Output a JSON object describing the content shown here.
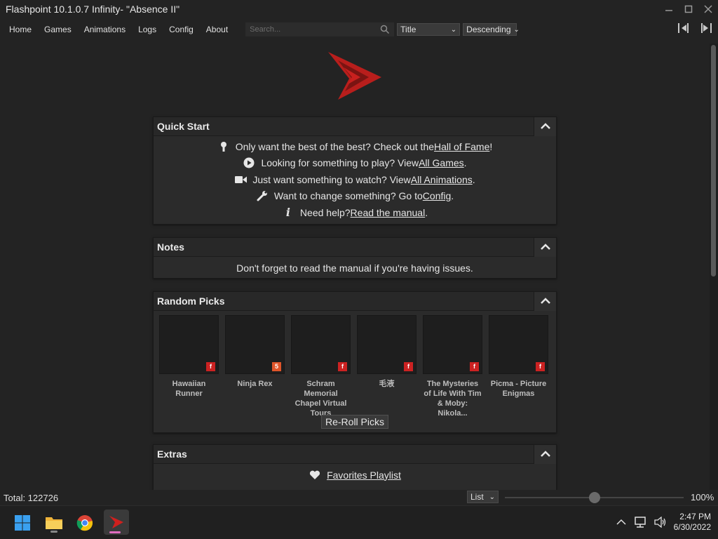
{
  "window": {
    "title": "Flashpoint 10.1.0.7 Infinity- \"Absence II\"",
    "controls": [
      "minimize-icon",
      "maximize-icon",
      "close-icon"
    ]
  },
  "menu": {
    "items": [
      "Home",
      "Games",
      "Animations",
      "Logs",
      "Config",
      "About"
    ]
  },
  "search": {
    "placeholder": "Search...",
    "value": ""
  },
  "sort_field": {
    "selected": "Title"
  },
  "sort_order": {
    "selected": "Descending"
  },
  "quick_start": {
    "title": "Quick Start",
    "lines": [
      {
        "icon": "award-icon",
        "pre": "Only want the best of the best? Check out the ",
        "link": "Hall of Fame",
        "post": "!"
      },
      {
        "icon": "play-circle-icon",
        "pre": "Looking for something to play? View ",
        "link": "All Games",
        "post": "."
      },
      {
        "icon": "video-camera-icon",
        "pre": "Just want something to watch? View ",
        "link": "All Animations",
        "post": "."
      },
      {
        "icon": "wrench-icon",
        "pre": "Want to change something? Go to ",
        "link": "Config",
        "post": "."
      },
      {
        "icon": "info-icon",
        "pre": "Need help? ",
        "link": "Read the manual",
        "post": "."
      }
    ]
  },
  "notes": {
    "title": "Notes",
    "text": "Don't forget to read the manual if you're having issues."
  },
  "random_picks": {
    "title": "Random Picks",
    "picks": [
      {
        "name": "Hawaiian Runner",
        "platform": "flash-icon",
        "badge": "f"
      },
      {
        "name": "Ninja Rex",
        "platform": "html5-icon",
        "badge": "5"
      },
      {
        "name": "Schram Memorial Chapel Virtual Tours",
        "platform": "flash-icon",
        "badge": "f"
      },
      {
        "name": "毛液",
        "platform": "flash-icon",
        "badge": "f"
      },
      {
        "name": "The Mysteries of Life With Tim & Moby: Nikola...",
        "platform": "flash-icon",
        "badge": "f"
      },
      {
        "name": "Picma - Picture Enigmas",
        "platform": "flash-icon",
        "badge": "f"
      }
    ],
    "reroll_label": "Re-Roll Picks"
  },
  "extras": {
    "title": "Extras",
    "items": [
      {
        "icon": "heart-icon",
        "label": "Favorites Playlist"
      }
    ]
  },
  "statusbar": {
    "total": "Total: 122726",
    "view_mode": "List",
    "zoom_label": "100%",
    "zoom_level": 0.5
  },
  "taskbar": {
    "apps": [
      "windows-start-icon",
      "file-explorer-icon",
      "chrome-icon",
      "flashpoint-icon"
    ],
    "time": "2:47 PM",
    "date": "6/30/2022"
  },
  "colors": {
    "background": "#232323",
    "panel": "#2b2b2b",
    "accent_red": "#c8201e",
    "flash_badge": "#cc2222",
    "html5_badge": "#e0552a"
  }
}
